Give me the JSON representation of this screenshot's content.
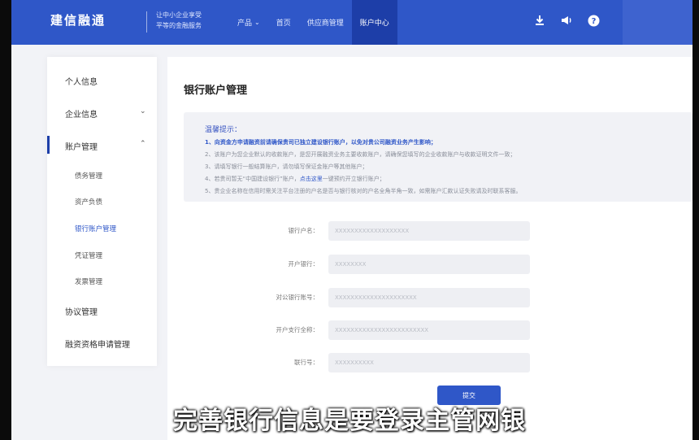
{
  "header": {
    "logo": "建信融通",
    "slogan_line1": "让中小企业享受",
    "slogan_line2": "平等的金融服务",
    "nav": [
      {
        "label": "产品",
        "has_caret": true
      },
      {
        "label": "首页"
      },
      {
        "label": "供应商管理"
      },
      {
        "label": "账户中心",
        "active": true
      }
    ],
    "icons": [
      "download-icon",
      "megaphone-icon",
      "help-icon"
    ]
  },
  "sidebar": {
    "items": [
      {
        "label": "个人信息"
      },
      {
        "label": "企业信息",
        "chevron": "⌄"
      },
      {
        "label": "账户管理",
        "chevron": "⌃",
        "active": true
      },
      {
        "label": "协议管理"
      },
      {
        "label": "融资资格申请管理"
      }
    ],
    "subitems": [
      {
        "label": "债务管理"
      },
      {
        "label": "资产负债"
      },
      {
        "label": "银行账户管理",
        "active": true
      },
      {
        "label": "凭证管理"
      },
      {
        "label": "发票管理"
      }
    ]
  },
  "main": {
    "title": "银行账户管理",
    "notice": {
      "title": "温馨提示：",
      "line1": "1、向资金方申请融资前请确保贵司已独立建设银行账户，以免对贵公司融资业务产生影响；",
      "line2": "2、该账户为您企业默认的收款账户，是您开展融资业务主要收款账户，请确保您填写的企业收款账户与收款证明文件一致；",
      "line3": "3、请填写银行一般结算账户，请勿填写保证金账户等其他账户；",
      "line4_pre": "4、若贵司暂无“中国建设银行”账户，",
      "line4_link": "点击这里",
      "line4_post": "一键预约开立银行账户；",
      "line5": "5、贵企业名称在信用时需关注平台注册的户名是否与银行核对的户名全角半角一致，如需账户汇款认证失败请及时联系客服。"
    },
    "form": [
      {
        "label": "银行户名：",
        "value": "XXXXXXXXXXXXXXXXXXX"
      },
      {
        "label": "开户银行：",
        "value": "XXXXXXXX"
      },
      {
        "label": "对公银行账号：",
        "value": "XXXXXXXXXXXXXXXXXXXXX"
      },
      {
        "label": "开户支行全称：",
        "value": "XXXXXXXXXXXXXXXXXXXXXXXX"
      },
      {
        "label": "联行号：",
        "value": "XXXXXXXXXX"
      }
    ],
    "submit_label": "提交"
  },
  "caption": "完善银行信息是要登录主管网银",
  "colors": {
    "primary": "#2f57c8",
    "nav_active": "#1d3ea8",
    "page_bg": "#f2f3f7"
  }
}
